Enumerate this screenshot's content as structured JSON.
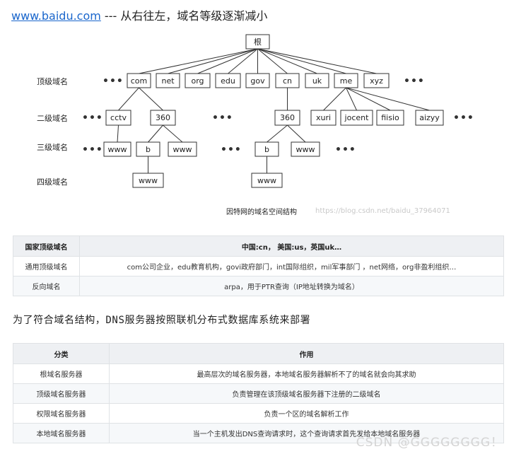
{
  "heading": {
    "link_text": "www.baidu.com",
    "text": " --- 从右往左，域名等级逐渐减小"
  },
  "chart_data": {
    "type": "tree",
    "caption": "因特网的域名空间结构",
    "levels": [
      "顶级域名",
      "二级域名",
      "三级域名",
      "四级域名"
    ],
    "root": "根",
    "top_level": [
      "com",
      "net",
      "org",
      "edu",
      "gov",
      "cn",
      "uk",
      "me",
      "xyz"
    ],
    "second_level": [
      {
        "label": "cctv",
        "parent": "com"
      },
      {
        "label": "360",
        "parent": "com"
      },
      {
        "label": "360",
        "parent": "cn"
      },
      {
        "label": "xuri",
        "parent": "me"
      },
      {
        "label": "jocent",
        "parent": "me"
      },
      {
        "label": "fiisio",
        "parent": "me"
      },
      {
        "label": "aizyy",
        "parent": "me"
      }
    ],
    "third_level": [
      {
        "label": "www",
        "parent": "cctv"
      },
      {
        "label": "b",
        "parent": "360 (com)"
      },
      {
        "label": "www",
        "parent": "360 (com)"
      },
      {
        "label": "b",
        "parent": "360 (cn)"
      },
      {
        "label": "www",
        "parent": "360 (cn)"
      }
    ],
    "fourth_level": [
      {
        "label": "www",
        "parent": "b (360.com)"
      },
      {
        "label": "www",
        "parent": "b (360.cn)"
      }
    ],
    "ellipsis": "•••",
    "watermark": "https://blog.csdn.net/baidu_37964071"
  },
  "table1": {
    "header": [
      "国家顶级域名",
      "中国:cn， 美国:us，英国uk…"
    ],
    "rows": [
      [
        "通用顶级域名",
        "com公司企业，edu教育机构，govi政府部门，int国际组织，mil军事部门 ，net网络，org非盈利组织…"
      ],
      [
        "反向域名",
        "arpa，用于PTR查询（IP地址转换为域名）"
      ]
    ]
  },
  "subheading": "为了符合域名结构，DNS服务器按照联机分布式数据库系统来部署",
  "table2": {
    "header": [
      "分类",
      "作用"
    ],
    "rows": [
      [
        "根域名服务器",
        "最高层次的域名服务器，本地域名服务器解析不了的域名就会向其求助"
      ],
      [
        "顶级域名服务器",
        "负责管理在该顶级域名服务器下注册的二级域名"
      ],
      [
        "权限域名服务器",
        "负责一个区的域名解析工作"
      ],
      [
        "本地域名服务器",
        "当一个主机发出DNS查询请求时，这个查询请求首先发给本地域名服务器"
      ]
    ]
  },
  "watermark_bottom": "CSDN @GGGGGGGG！"
}
